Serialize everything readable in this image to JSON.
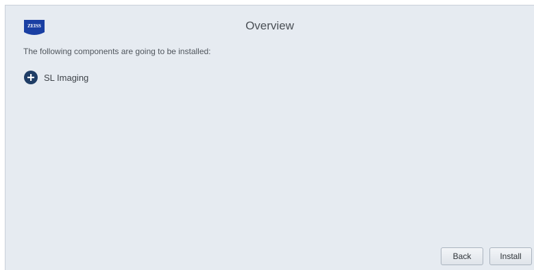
{
  "header": {
    "logo_text": "ZEISS",
    "title": "Overview"
  },
  "main": {
    "intro": "The following components are going to be installed:",
    "components": [
      {
        "label": "SL Imaging",
        "icon": "plus-circle-icon"
      }
    ]
  },
  "footer": {
    "back_label": "Back",
    "install_label": "Install"
  },
  "colors": {
    "background": "#e6ebf1",
    "accent": "#1f3d66",
    "logo": "#1a3fa3"
  }
}
